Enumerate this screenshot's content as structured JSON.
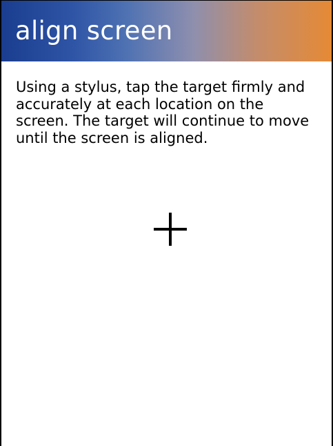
{
  "header": {
    "title": "align screen",
    "gradient_start": "#1a3d8f",
    "gradient_end": "#e58a35"
  },
  "main": {
    "instructions": "Using a stylus, tap the target firmly and accurately at each location on the screen. The target will continue to move until the screen is aligned.",
    "target_icon": "crosshair-icon"
  }
}
